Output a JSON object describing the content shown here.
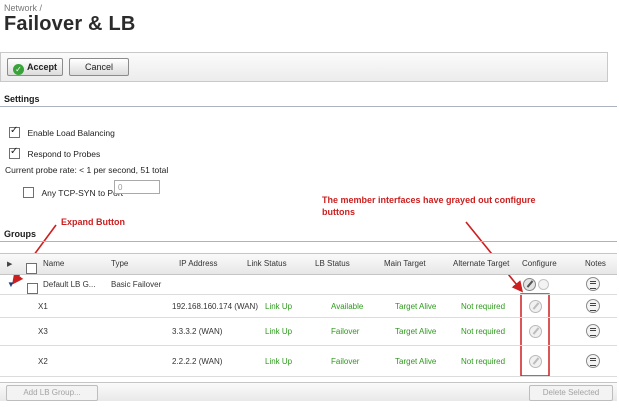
{
  "breadcrumb": "Network /",
  "page_title": "Failover & LB",
  "toolbar": {
    "accept_label": "Accept",
    "cancel_label": "Cancel"
  },
  "settings": {
    "title": "Settings",
    "enable_load_balancing": {
      "label": "Enable Load Balancing",
      "checked": true
    },
    "respond_to_probes": {
      "label": "Respond to Probes",
      "checked": true
    },
    "probe_rate_text": "Current probe rate: < 1 per second, 51 total",
    "any_tcp_syn": {
      "label": "Any TCP-SYN to Port",
      "checked": false,
      "value": "0"
    }
  },
  "annotations": {
    "expand_button": "Expand Button",
    "configure_note": "The member interfaces have grayed out configure buttons",
    "color": "#cc1f1f"
  },
  "groups": {
    "title": "Groups",
    "columns": [
      "Name",
      "Type",
      "IP Address",
      "Link Status",
      "LB Status",
      "Main Target",
      "Alternate Target",
      "Configure",
      "Notes"
    ],
    "group_row": {
      "name": "Default LB G...",
      "type": "Basic Failover"
    },
    "members": [
      {
        "name": "X1",
        "ip": "192.168.160.174 (WAN)",
        "link_status": "Link Up",
        "lb_status": "Available",
        "main_target": "Target Alive",
        "alternate_target": "Not required"
      },
      {
        "name": "X3",
        "ip": "3.3.3.2 (WAN)",
        "link_status": "Link Up",
        "lb_status": "Failover",
        "main_target": "Target Alive",
        "alternate_target": "Not required"
      },
      {
        "name": "X2",
        "ip": "2.2.2.2 (WAN)",
        "link_status": "Link Up",
        "lb_status": "Failover",
        "main_target": "Target Alive",
        "alternate_target": "Not required"
      }
    ],
    "add_button": "Add LB Group...",
    "delete_button": "Delete Selected"
  },
  "colors": {
    "status_green": "#2e9a1c",
    "annotation_red": "#cc1f1f"
  }
}
